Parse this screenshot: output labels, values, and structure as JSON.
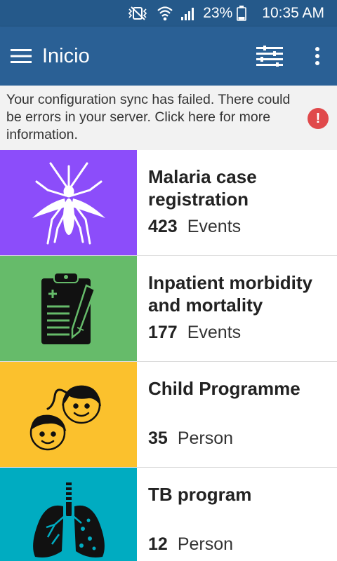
{
  "status_bar": {
    "battery": "23%",
    "time": "10:35 AM",
    "icons": [
      "vibrate-icon",
      "wifi-icon",
      "signal-icon",
      "battery-icon"
    ]
  },
  "app_bar": {
    "title": "Inicio",
    "icons": [
      "menu-icon",
      "filter-icon",
      "more-vert-icon"
    ]
  },
  "sync_banner": {
    "message": "Your configuration sync has failed. There could be errors in your server. Click here for more information.",
    "alert_glyph": "!",
    "alert_color": "#e0494b"
  },
  "programs": [
    {
      "name": "Malaria case registration",
      "count": "423",
      "unit": "Events",
      "color": "#8c4dfa",
      "icon": "mosquito-icon"
    },
    {
      "name": "Inpatient morbidity and mortality",
      "count": "177",
      "unit": "Events",
      "color": "#66bb6a",
      "icon": "clipboard-icon"
    },
    {
      "name": "Child Programme",
      "count": "35",
      "unit": "Person",
      "color": "#fbc12d",
      "icon": "children-icon"
    },
    {
      "name": "TB program",
      "count": "12",
      "unit": "Person",
      "color": "#00acc1",
      "icon": "lungs-icon"
    }
  ],
  "colors": {
    "status_bar": "#25598a",
    "app_bar": "#2a6095"
  }
}
